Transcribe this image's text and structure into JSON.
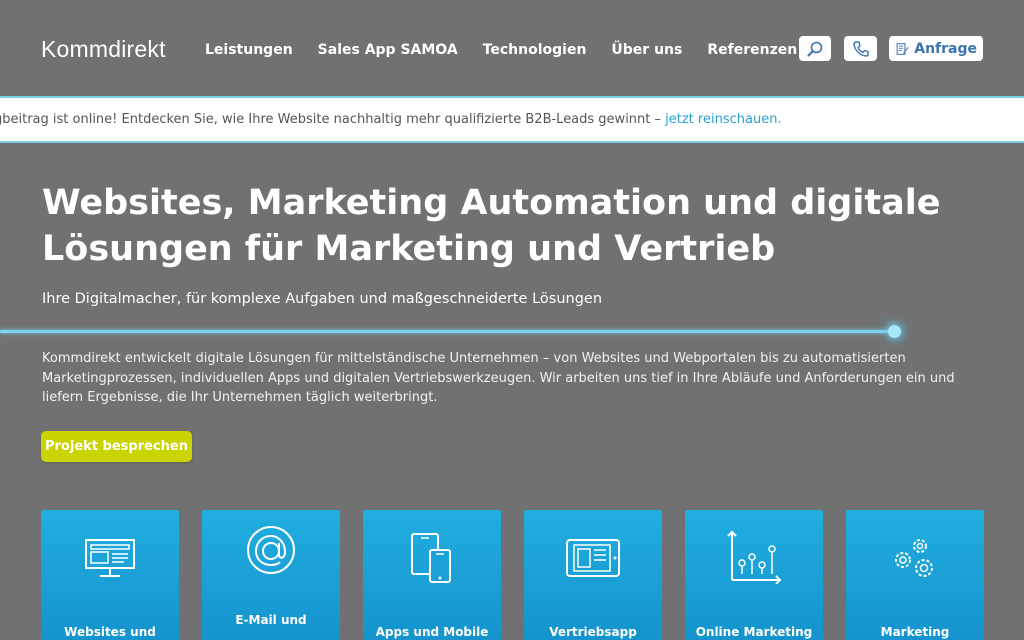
{
  "header": {
    "logo": "Kommdirekt",
    "nav": [
      "Leistungen",
      "Sales App SAMOA",
      "Technologien",
      "Über uns",
      "Referenzen"
    ],
    "anfrage_label": "Anfrage",
    "icons": {
      "search": "search-icon",
      "phone": "phone-icon",
      "anfrage": "form-icon"
    }
  },
  "announcement": {
    "text": "gbeitrag ist online! Entdecken Sie, wie Ihre Website nachhaltig mehr qualifizierte B2B-Leads gewinnt – ",
    "link": "jetzt reinschauen."
  },
  "hero": {
    "title_line1": "Websites, Marketing Automation und digitale",
    "title_line2": "Lösungen für Marketing und Vertrieb",
    "subtitle": "Ihre Digitalmacher, für komplexe Aufgaben und maßgeschneiderte Lösungen",
    "description": "Kommdirekt entwickelt digitale Lösungen für mittelständische Unternehmen – von Websites und Webportalen bis zu automatisierten Marketingprozessen, individuellen Apps und digitalen Vertriebswerkzeugen. Wir arbeiten uns tief in Ihre Abläufe und Anforderungen ein und liefern Ergebnisse, die Ihr Unternehmen täglich weiterbringt.",
    "cta": "Projekt besprechen"
  },
  "cards": [
    {
      "label": "Websites und",
      "icon": "monitor-icon"
    },
    {
      "label": "E-Mail und",
      "icon": "at-icon"
    },
    {
      "label": "Apps und Mobile",
      "icon": "devices-icon"
    },
    {
      "label": "Vertriebsapp",
      "icon": "tablet-icon"
    },
    {
      "label": "Online Marketing",
      "icon": "analytics-icon"
    },
    {
      "label": "Marketing",
      "icon": "gears-icon"
    }
  ],
  "colors": {
    "background": "#717171",
    "accent": "#7fd3ee",
    "cta": "#c9d400",
    "card": "#1ea5da",
    "link": "#2a9fd0"
  }
}
